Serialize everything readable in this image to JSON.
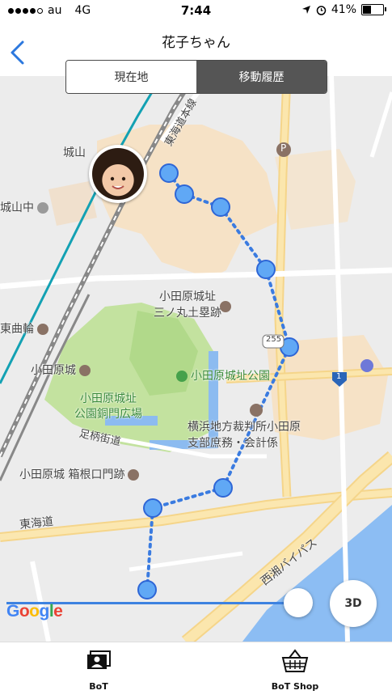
{
  "status_bar": {
    "carrier": "au",
    "network": "4G",
    "time": "7:44",
    "battery": "41%",
    "battery_level": 0.41,
    "signal_bars": 4
  },
  "nav": {
    "title": "花子ちゃん"
  },
  "segments": [
    {
      "label": "現在地",
      "selected": false
    },
    {
      "label": "移動履歴",
      "selected": true
    }
  ],
  "map": {
    "labels": {
      "castle_mountain": "城山",
      "castle_mountain_jhs": "城山中",
      "tokaido_line": "東海道本線",
      "odawara_castle": "小田原城",
      "sannomaru": "小田原城址\n三ノ丸土塁跡",
      "higashi_kuruwa": "東曲輪",
      "castle_park": "小田原城址公園",
      "bronze_plaza": "小田原城址\n公園銅門広場",
      "ashigara_road": "足柄街道",
      "hakone_gate": "小田原城 箱根口門跡",
      "court": "横浜地方裁判所小田原\n支部庶務・会計係",
      "tokaido": "東海道",
      "seisho_bypass": "西湘バイパス",
      "route_255": "255",
      "route_1": "1",
      "parking": "P"
    },
    "google_logo": "Google",
    "button_3d": "3D"
  },
  "tabbar": [
    {
      "label": "BoT",
      "icon": "bot-device-icon"
    },
    {
      "label": "BoT Shop",
      "icon": "shopping-basket-icon"
    }
  ],
  "colors": {
    "route": "#3a7be0",
    "accent": "#2c78de",
    "segment_on": "#555555"
  }
}
